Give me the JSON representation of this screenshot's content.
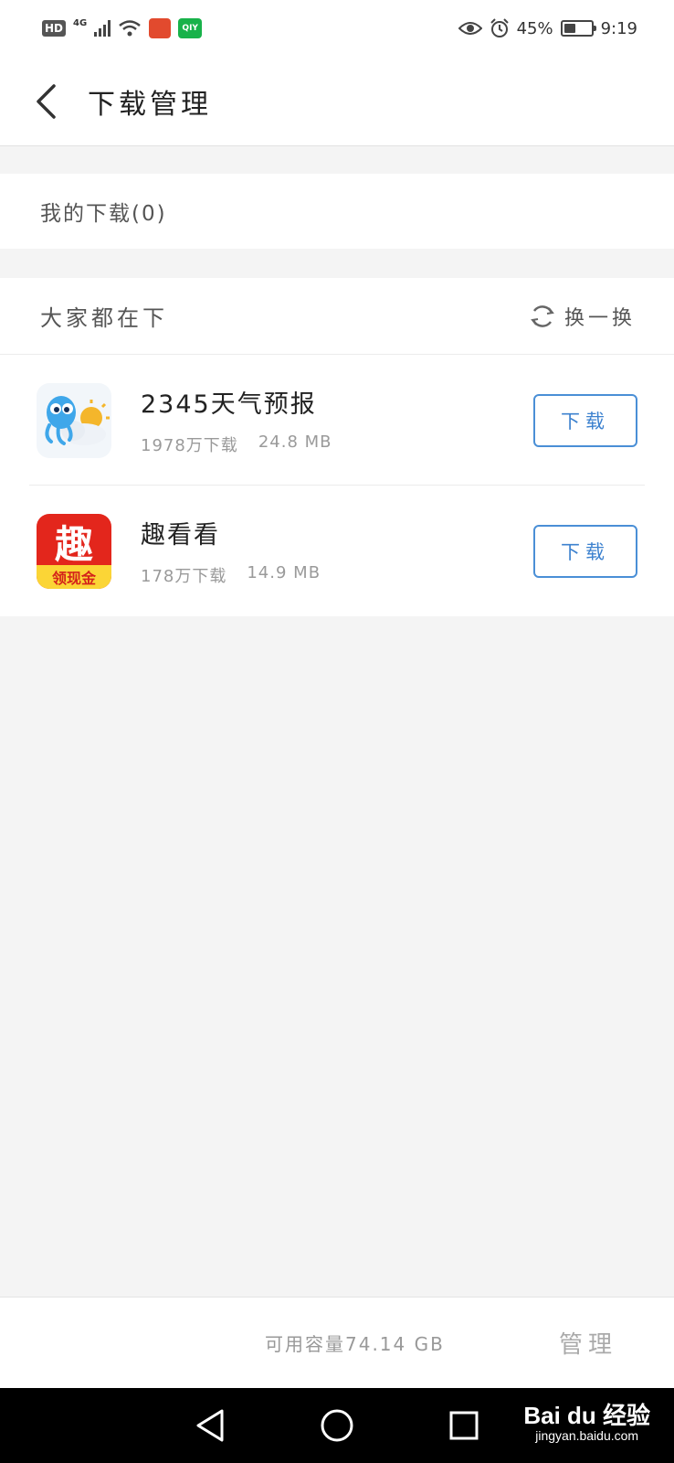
{
  "status_bar": {
    "hd_badge": "HD",
    "network": "4G",
    "app_badge_green": "QIY",
    "battery_percent": "45%",
    "battery_level": 0.45,
    "time": "9:19"
  },
  "header": {
    "title": "下载管理"
  },
  "my_downloads": {
    "label": "我的下载(0)"
  },
  "recommend": {
    "title": "大家都在下",
    "refresh_label": "换一换",
    "apps": [
      {
        "name": "2345天气预报",
        "downloads": "1978万下载",
        "size": "24.8 MB",
        "button": "下载",
        "icon": "weather-cloud-sun-icon"
      },
      {
        "name": "趣看看",
        "downloads": "178万下载",
        "size": "14.9 MB",
        "button": "下载",
        "icon": "qu-kankan-icon",
        "icon_char": "趣",
        "icon_banner": "领现金"
      }
    ]
  },
  "footer": {
    "storage": "可用容量74.14 GB",
    "manage": "管理"
  },
  "watermark": {
    "logo": "Bai du 经验",
    "url": "jingyan.baidu.com"
  },
  "colors": {
    "accent": "#3d82cf",
    "background": "#f4f4f4"
  }
}
